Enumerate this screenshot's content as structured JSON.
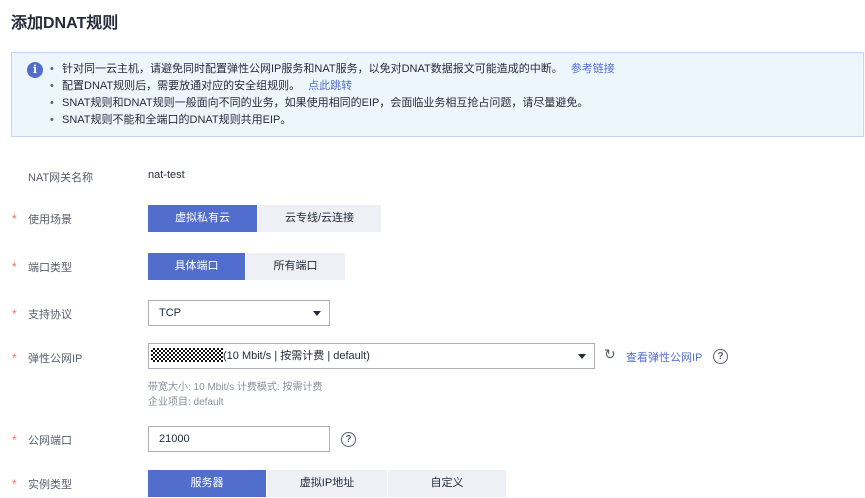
{
  "page": {
    "title": "添加DNAT规则"
  },
  "notice": {
    "icon": "info-icon",
    "items": [
      {
        "text": "针对同一云主机，请避免同时配置弹性公网IP服务和NAT服务，以免对DNAT数据报文可能造成的中断。",
        "link": "参考链接"
      },
      {
        "text": "配置DNAT规则后，需要放通对应的安全组规则。",
        "link": "点此跳转"
      },
      {
        "text": "SNAT规则和DNAT规则一般面向不同的业务，如果使用相同的EIP，会面临业务相互抢占问题，请尽量避免。",
        "link": ""
      },
      {
        "text": "SNAT规则不能和全端口的DNAT规则共用EIP。",
        "link": ""
      }
    ]
  },
  "form": {
    "required_mark": "*",
    "nat_gateway": {
      "label": "NAT网关名称",
      "value": "nat-test"
    },
    "scenario": {
      "label": "使用场景",
      "options": [
        "虚拟私有云",
        "云专线/云连接"
      ],
      "selected": 0
    },
    "port_type": {
      "label": "端口类型",
      "options": [
        "具体端口",
        "所有端口"
      ],
      "selected": 0
    },
    "protocol": {
      "label": "支持协议",
      "value": "TCP"
    },
    "eip": {
      "label": "弹性公网IP",
      "value": "(10 Mbit/s | 按需计费 | default)",
      "refresh_icon": "refresh-icon",
      "view_link": "查看弹性公网IP",
      "hint_line1": "带宽大小: 10 Mbit/s 计费模式: 按需计费",
      "hint_line2": "企业项目: default"
    },
    "public_port": {
      "label": "公网端口",
      "value": "21000"
    },
    "instance_type": {
      "label": "实例类型",
      "options": [
        "服务器",
        "虚拟IP地址",
        "自定义"
      ],
      "selected": 0
    }
  },
  "colors": {
    "accent": "#526ecc",
    "required": "#f66f6a",
    "notice_bg": "#eef6fd",
    "notice_border": "#bfd7f2",
    "segment_bg": "#eef0f5"
  }
}
